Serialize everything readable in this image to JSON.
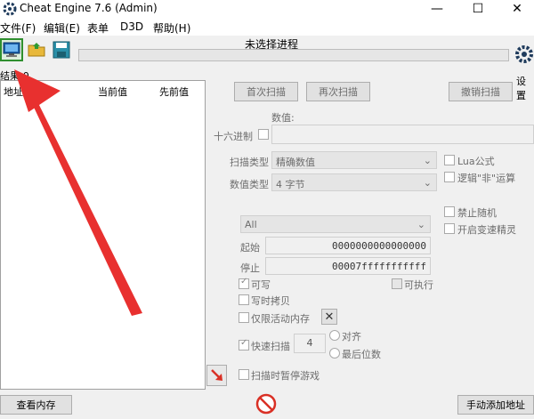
{
  "window": {
    "title": "Cheat Engine 7.6 (Admin)"
  },
  "menu": [
    "文件(F)",
    "编辑(E)",
    "表单",
    "D3D",
    "帮助(H)"
  ],
  "toolbar": {
    "process_label": "未选择进程",
    "settings_label": "设置"
  },
  "results": {
    "found": "结果:0",
    "columns": [
      "地址",
      "当前值",
      "先前值"
    ]
  },
  "scan_buttons": {
    "first": "首次扫描",
    "next": "再次扫描",
    "undo": "撤销扫描"
  },
  "value": {
    "label": "数值:",
    "hex_label": "十六进制",
    "input": ""
  },
  "scan_type": {
    "label": "扫描类型",
    "selected": "精确数值"
  },
  "value_type": {
    "label": "数值类型",
    "selected": "4 字节"
  },
  "options_right": {
    "lua": "Lua公式",
    "not": "逻辑\"非\"运算",
    "no_random": "禁止随机",
    "speedhack": "开启变速精灵"
  },
  "memory": {
    "region": "All",
    "start_label": "起始",
    "start": "0000000000000000",
    "stop_label": "停止",
    "stop": "00007fffffffffff",
    "writable": "可写",
    "executable": "可执行",
    "copy_on_write": "写时拷贝",
    "active_only": "仅限活动内存",
    "fast_scan": "快速扫描",
    "fast_value": "4",
    "align": "对齐",
    "last_digits": "最后位数",
    "pause": "扫描时暂停游戏"
  },
  "bottom": {
    "view_memory": "查看内存",
    "add_address": "手动添加地址"
  },
  "colors": {
    "arrow": "#e8302f"
  }
}
